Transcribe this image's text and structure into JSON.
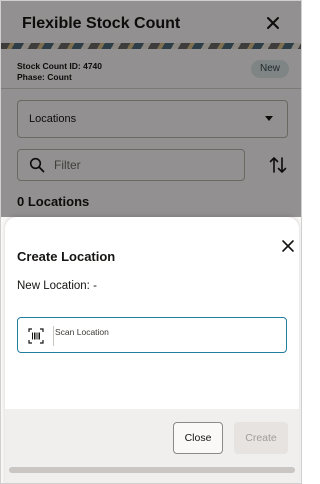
{
  "header": {
    "title": "Flexible Stock Count",
    "close_icon": "close-icon"
  },
  "info": {
    "stock_count_id": "Stock Count ID: 4740",
    "phase": "Phase: Count",
    "status_badge": "New"
  },
  "locations_select": {
    "selected": "Locations"
  },
  "filter": {
    "placeholder": "Filter",
    "icon": "search-icon"
  },
  "sort_icon": "sort-icon",
  "count_label": "0 Locations",
  "dialog": {
    "title": "Create Location",
    "new_location": "New Location: -",
    "scan_placeholder": "Scan Location",
    "scan_icon": "barcode-scan-icon",
    "close_label": "Close",
    "create_label": "Create"
  },
  "colors": {
    "accent": "#227e9e",
    "badge_bg": "#dbe4e5",
    "scrim": "#000000"
  }
}
